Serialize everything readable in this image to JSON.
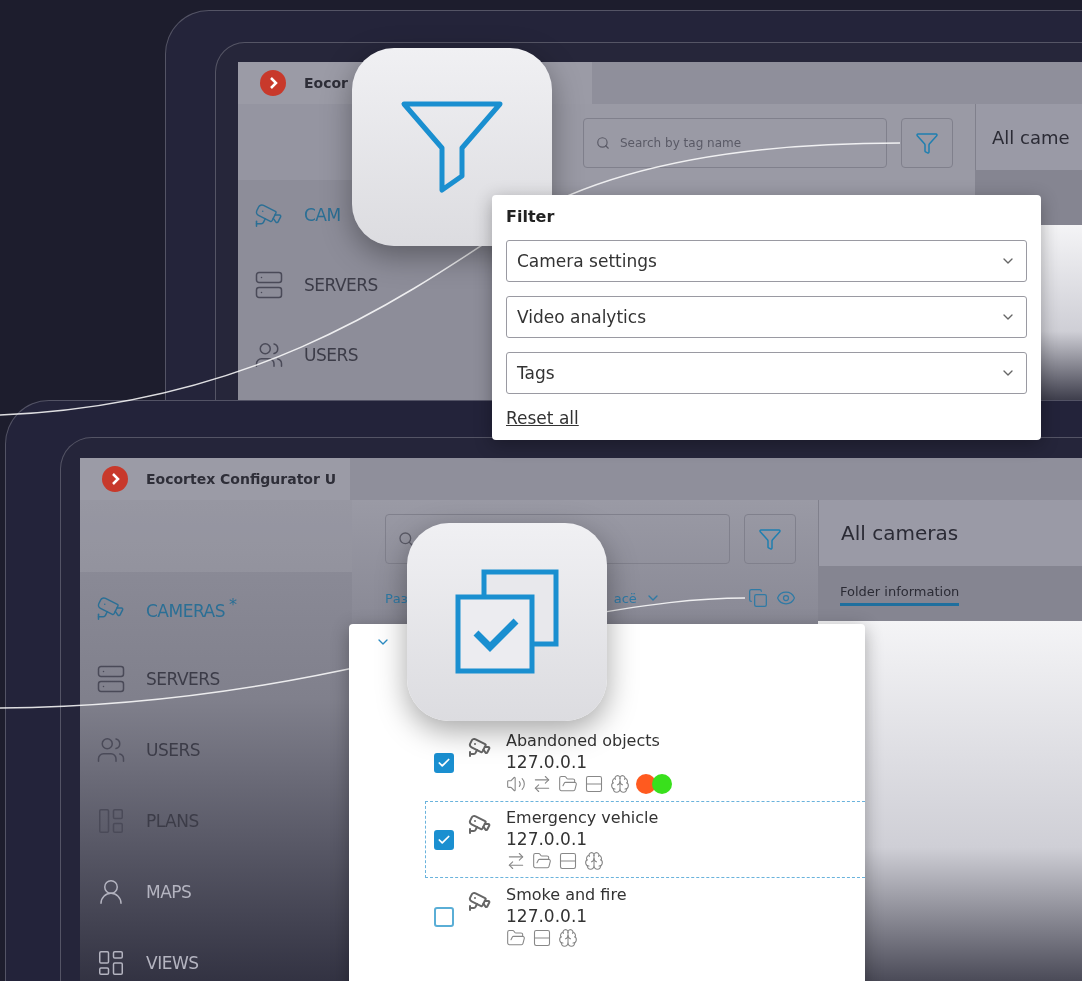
{
  "back_window": {
    "title": "Eocor",
    "sidebar": [
      {
        "label": "CAM",
        "selected": true
      },
      {
        "label": "SERVERS",
        "selected": false
      },
      {
        "label": "USERS",
        "selected": false
      }
    ],
    "search": {
      "placeholder": "Search by tag name"
    },
    "header": "All came"
  },
  "filter_popup": {
    "title": "Filter",
    "dropdowns": [
      "Camera settings",
      "Video analytics",
      "Tags"
    ],
    "reset_link": "Reset all"
  },
  "front_window": {
    "title": "Eocortex Configurator U",
    "sidebar": [
      {
        "label": "CAMERAS",
        "badge": "*",
        "selected": true
      },
      {
        "label": "SERVERS",
        "selected": false
      },
      {
        "label": "USERS",
        "selected": false
      },
      {
        "label": "PLANS",
        "selected": false
      },
      {
        "label": "MAPS",
        "selected": false
      },
      {
        "label": "VIEWS",
        "selected": false
      }
    ],
    "toolbar_texts": [
      "Раз",
      "асё"
    ],
    "header": "All cameras",
    "tabs": [
      {
        "label": "Folder information",
        "selected": true
      }
    ]
  },
  "camera_list": {
    "cameras": [
      {
        "name": "Abandoned objects",
        "address": "127.0.0.1",
        "checked": true,
        "focused": false,
        "features": [
          {
            "kind": "audio"
          },
          {
            "kind": "ptz"
          },
          {
            "kind": "archive"
          },
          {
            "kind": "storage"
          },
          {
            "kind": "analytics"
          }
        ],
        "status": [
          {
            "color": "#ff5a1f"
          },
          {
            "color": "#39e01c"
          }
        ]
      },
      {
        "name": "Emergency vehicle",
        "address": "127.0.0.1",
        "checked": true,
        "focused": true,
        "features": [
          {
            "kind": "ptz"
          },
          {
            "kind": "archive"
          },
          {
            "kind": "storage"
          },
          {
            "kind": "analytics"
          }
        ]
      },
      {
        "name": "Smoke and fire",
        "address": "127.0.0.1",
        "checked": false,
        "focused": false,
        "features": [
          {
            "kind": "archive"
          },
          {
            "kind": "storage"
          },
          {
            "kind": "analytics"
          }
        ]
      }
    ]
  }
}
